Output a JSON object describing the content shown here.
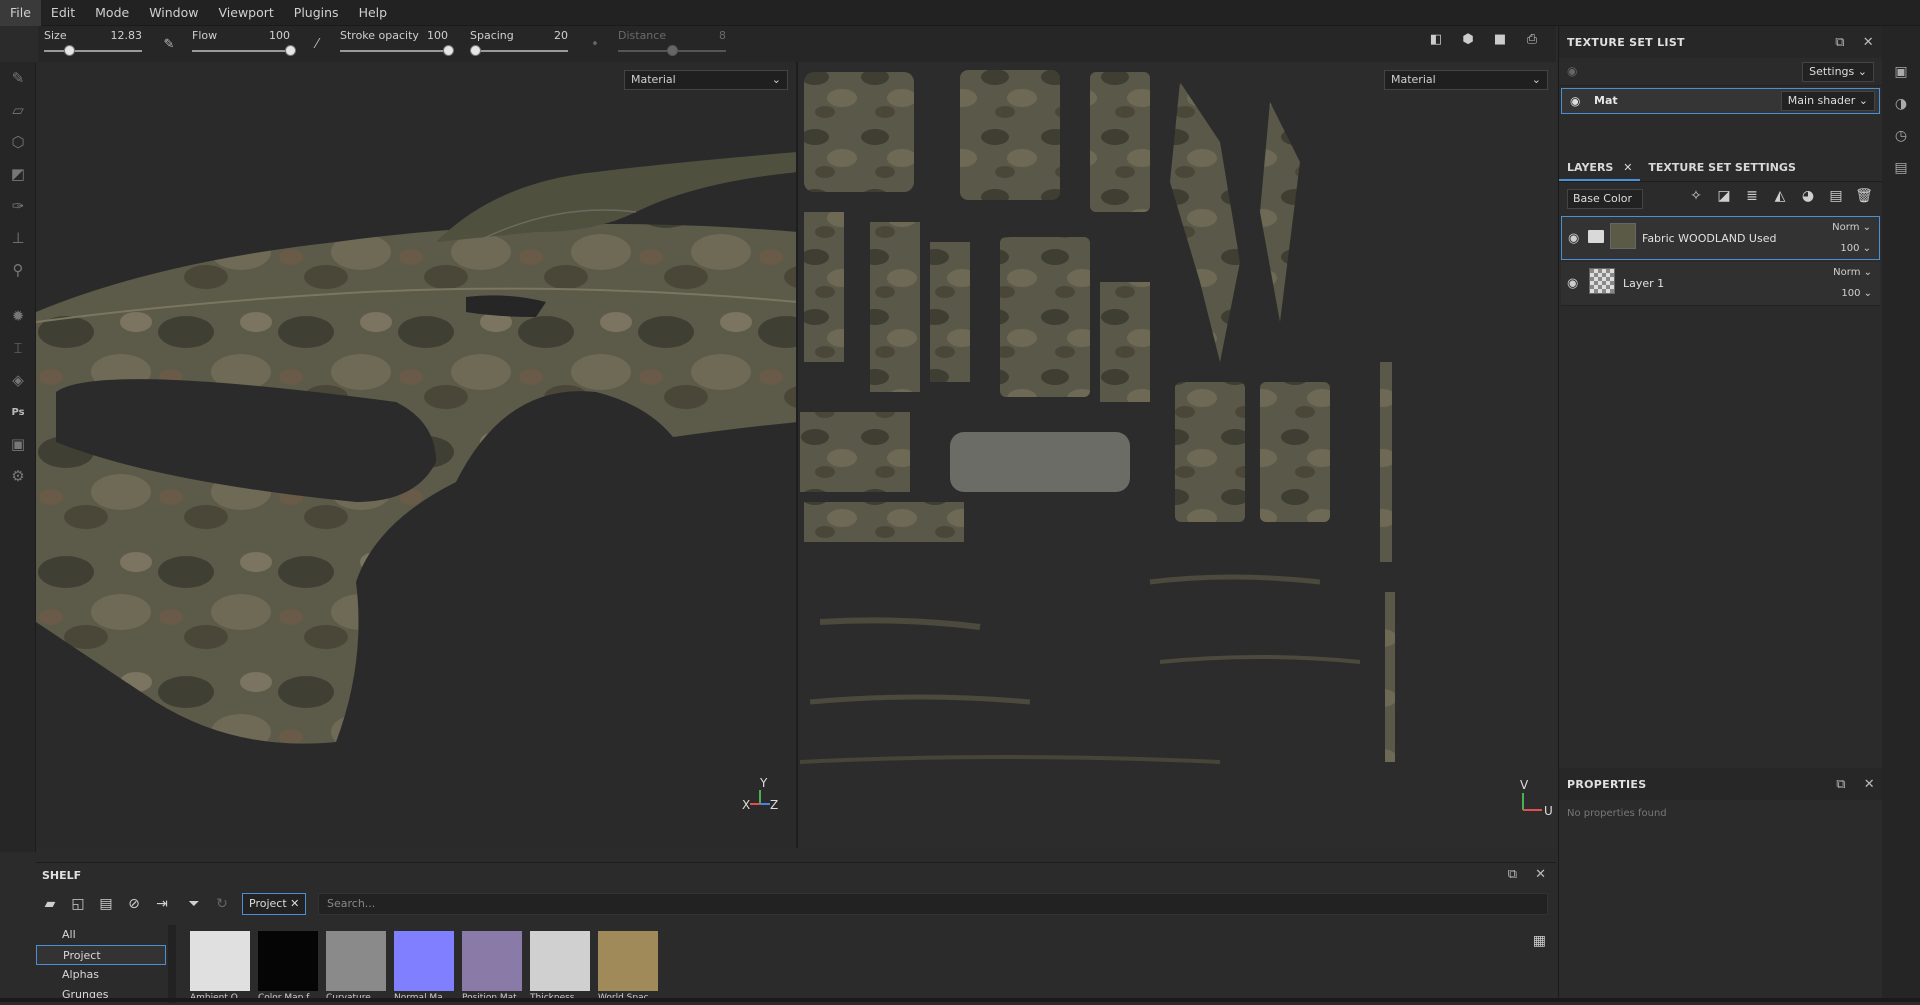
{
  "menu": [
    "File",
    "Edit",
    "Mode",
    "Window",
    "Viewport",
    "Plugins",
    "Help"
  ],
  "tool_options": {
    "size": {
      "label": "Size",
      "value": "12.83",
      "fraction": 0.25
    },
    "flow": {
      "label": "Flow",
      "value": "100",
      "fraction": 1.0
    },
    "stroke_opacity": {
      "label": "Stroke opacity",
      "value": "100",
      "fraction": 1.0
    },
    "spacing": {
      "label": "Spacing",
      "value": "20",
      "fraction": 0.05
    },
    "distance": {
      "label": "Distance",
      "value": "8",
      "fraction": 0.5
    }
  },
  "viewport3d": {
    "material_select": "Material",
    "gizmo": {
      "y": "Y",
      "x": "X",
      "z": "Z"
    }
  },
  "viewport2d": {
    "material_select": "Material",
    "gizmo": {
      "v": "V",
      "u": "U"
    }
  },
  "texture_set_list": {
    "title": "TEXTURE SET LIST",
    "settings_label": "Settings",
    "material": {
      "name": "Mat",
      "shader": "Main shader"
    }
  },
  "layers_panel": {
    "tabs": [
      "LAYERS",
      "TEXTURE SET SETTINGS"
    ],
    "channel": "Base Color",
    "layers": [
      {
        "name": "Fabric WOODLAND Used",
        "blend": "Norm",
        "opacity": "100"
      },
      {
        "name": "Layer 1",
        "blend": "Norm",
        "opacity": "100"
      }
    ]
  },
  "properties": {
    "title": "PROPERTIES",
    "empty": "No properties found"
  },
  "shelf": {
    "title": "SHELF",
    "filter_tag": "Project",
    "search_placeholder": "Search...",
    "categories": [
      "All",
      "Project",
      "Alphas",
      "Grunges"
    ],
    "thumbnails": [
      {
        "label": "Ambient O...",
        "color": "#e0e0e0"
      },
      {
        "label": "Color Map f...",
        "color": "#050505"
      },
      {
        "label": "Curvature ...",
        "color": "#8a8a8a"
      },
      {
        "label": "Normal Ma...",
        "color": "#7f7fff"
      },
      {
        "label": "Position Mat...",
        "color": "#8a7aa8"
      },
      {
        "label": "Thickness ...",
        "color": "#d0d0d0"
      },
      {
        "label": "World Spac...",
        "color": "#a08a5a"
      }
    ]
  },
  "colors": {
    "accent": "#4b8fd6"
  }
}
